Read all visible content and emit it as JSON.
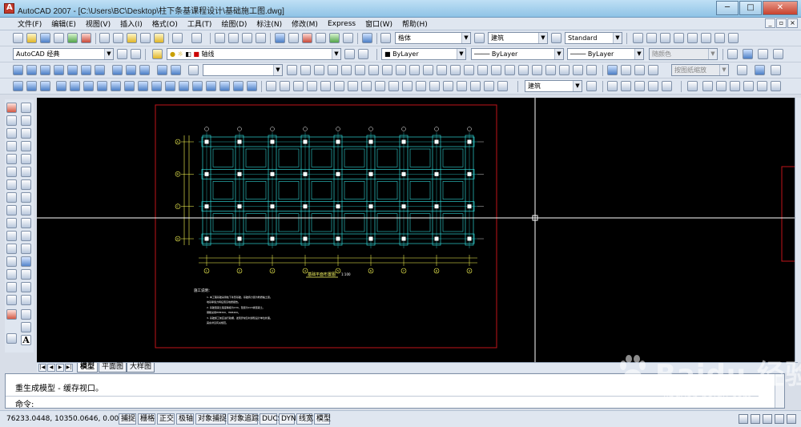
{
  "window": {
    "title": "AutoCAD 2007 - [C:\\Users\\BC\\Desktop\\柱下条基课程设计\\基础施工图.dwg]",
    "minimize": "─",
    "maximize": "□",
    "close": "✕"
  },
  "menu": [
    "文件(F)",
    "编辑(E)",
    "视图(V)",
    "插入(I)",
    "格式(O)",
    "工具(T)",
    "绘图(D)",
    "标注(N)",
    "修改(M)",
    "Express",
    "窗口(W)",
    "帮助(H)"
  ],
  "toolbar": {
    "font_combo": "楷体",
    "dimstyle_combo": "建筑",
    "textstyle_combo": "Standard",
    "workspace_combo": "AutoCAD 经典",
    "layer_combo": "轴线",
    "color_combo": "ByLayer",
    "linetype_combo": "ByLayer",
    "lineweight_combo": "ByLayer",
    "plotstyle_combo": "随颜色",
    "dim_combo_2": "建筑",
    "viewport_scale_combo": "按图纸缩放"
  },
  "drawing": {
    "plan_title": "基础平面布置图",
    "plan_scale": "1:100",
    "notes_title": "施工说明：",
    "notes_lines": [
      "1. 本工程基础采用柱下条形基础，基础持力层为粉质黏土层。",
      "   地基承载力特征值见地质报告。",
      "2. 基础混凝土强度等级为C30，垫层为C15素混凝土。",
      "   钢筋采用HPB300、HRB400。",
      "3. 基础施工前应进行验槽，发现异常及时通知设计单位处理。",
      "   其余详见有关规范。"
    ],
    "axis_labels_top": [
      "1",
      "2",
      "3",
      "4",
      "5",
      "6",
      "7",
      "8",
      "9"
    ],
    "axis_labels_left": [
      "A",
      "B",
      "C",
      "D"
    ]
  },
  "tabs": {
    "model": "模型",
    "layout1": "平面图",
    "layout2": "大样图"
  },
  "command": {
    "history": "重生成模型 - 缓存视口。",
    "prompt": "命令:"
  },
  "status": {
    "coords": "76233.0448,  10350.0646,  0.0000",
    "buttons": [
      "捕捉",
      "栅格",
      "正交",
      "极轴",
      "对象捕捉",
      "对象追踪",
      "DUCS",
      "DYN",
      "线宽",
      "模型"
    ]
  },
  "watermark": {
    "text": "Baidu 经验",
    "url": "jingyan.baidu.com"
  }
}
